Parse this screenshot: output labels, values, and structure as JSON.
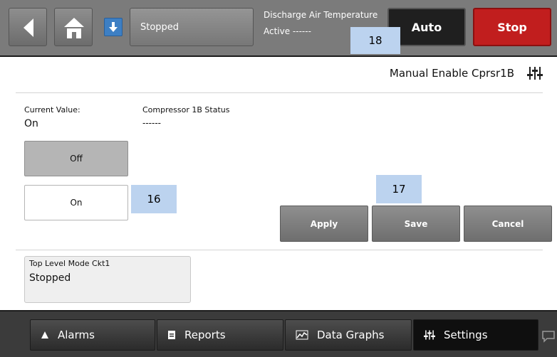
{
  "topbar": {
    "status_label": "Stopped",
    "dat_title": "Discharge Air Temperature",
    "dat_value": "Active ------",
    "auto_label": "Auto",
    "stop_label": "Stop"
  },
  "page": {
    "title": "Manual Enable Cprsr1B"
  },
  "current": {
    "label": "Current Value:",
    "value": "On"
  },
  "compressor": {
    "label": "Compressor 1B Status",
    "value": "------"
  },
  "options": {
    "off_label": "Off",
    "on_label": "On"
  },
  "actions": {
    "apply_label": "Apply",
    "save_label": "Save",
    "cancel_label": "Cancel"
  },
  "mode": {
    "label": "Top Level Mode Ckt1",
    "value": "Stopped"
  },
  "nav": {
    "alarms_label": "Alarms",
    "reports_label": "Reports",
    "graphs_label": "Data Graphs",
    "settings_label": "Settings"
  },
  "badges": {
    "b16": "16",
    "b17": "17",
    "b18": "18"
  },
  "icons": [
    "back-arrow-icon",
    "home-icon",
    "download-icon",
    "settings-sliders-icon",
    "bell-icon",
    "document-icon",
    "chart-icon",
    "chat-icon"
  ],
  "colors": {
    "topbar": "#7b7b7b",
    "stop": "#c11e1e",
    "auto": "#1f1f1f",
    "badge": "#bcd3ef",
    "bottombar": "#3b3b3b"
  }
}
